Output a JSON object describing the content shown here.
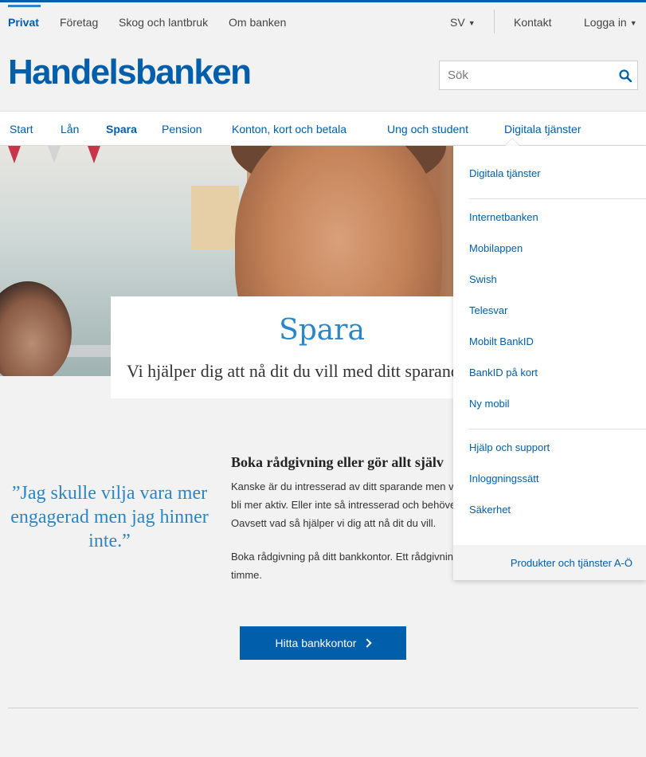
{
  "top_nav": {
    "items": [
      {
        "label": "Privat",
        "active": true
      },
      {
        "label": "Företag"
      },
      {
        "label": "Skog och lantbruk"
      },
      {
        "label": "Om banken"
      }
    ],
    "language": "SV",
    "contact": "Kontakt",
    "login": "Logga in"
  },
  "header": {
    "logo": "Handelsbanken",
    "search_placeholder": "Sök"
  },
  "main_nav": {
    "items": [
      {
        "label": "Start"
      },
      {
        "label": "Lån"
      },
      {
        "label": "Spara",
        "active": true
      },
      {
        "label": "Pension"
      },
      {
        "label": "Konton, kort och betala"
      },
      {
        "label": "Ung och student"
      },
      {
        "label": "Digitala tjänster",
        "open": true
      }
    ]
  },
  "hero": {
    "title": "Spara",
    "subtitle": "Vi hjälper dig att nå dit du vill med ditt sparande"
  },
  "quote": {
    "text": "”Jag skulle vilja vara mer engagerad men jag hinner inte.”"
  },
  "content": {
    "heading": "Boka rådgivning eller gör allt själv",
    "para1_lines": [
      "Kanske är du intresserad av ditt sparande men vill",
      "bli mer aktiv. Eller inte så intresserad och behöver",
      "Oavsett vad så hjälper vi dig att nå dit du vill."
    ],
    "para2_lines": [
      "Boka rådgivning på ditt bankkontor. Ett rådgivningsmöte",
      "timme."
    ]
  },
  "cta": {
    "label": "Hitta bankkontor"
  },
  "dropdown": {
    "heading": "Digitala tjänster",
    "items": [
      "Internetbanken",
      "Mobilappen",
      "Swish",
      "Telesvar",
      "Mobilt BankID",
      "BankID på kort",
      "Ny mobil"
    ],
    "support_items": [
      "Hjälp och support",
      "Inloggningssätt",
      "Säkerhet"
    ],
    "footer_link": "Produkter och tjänster A-Ö"
  },
  "colors": {
    "brand_blue": "#005eab",
    "accent_blue": "#2a86c8",
    "background": "#f2f2f2"
  }
}
